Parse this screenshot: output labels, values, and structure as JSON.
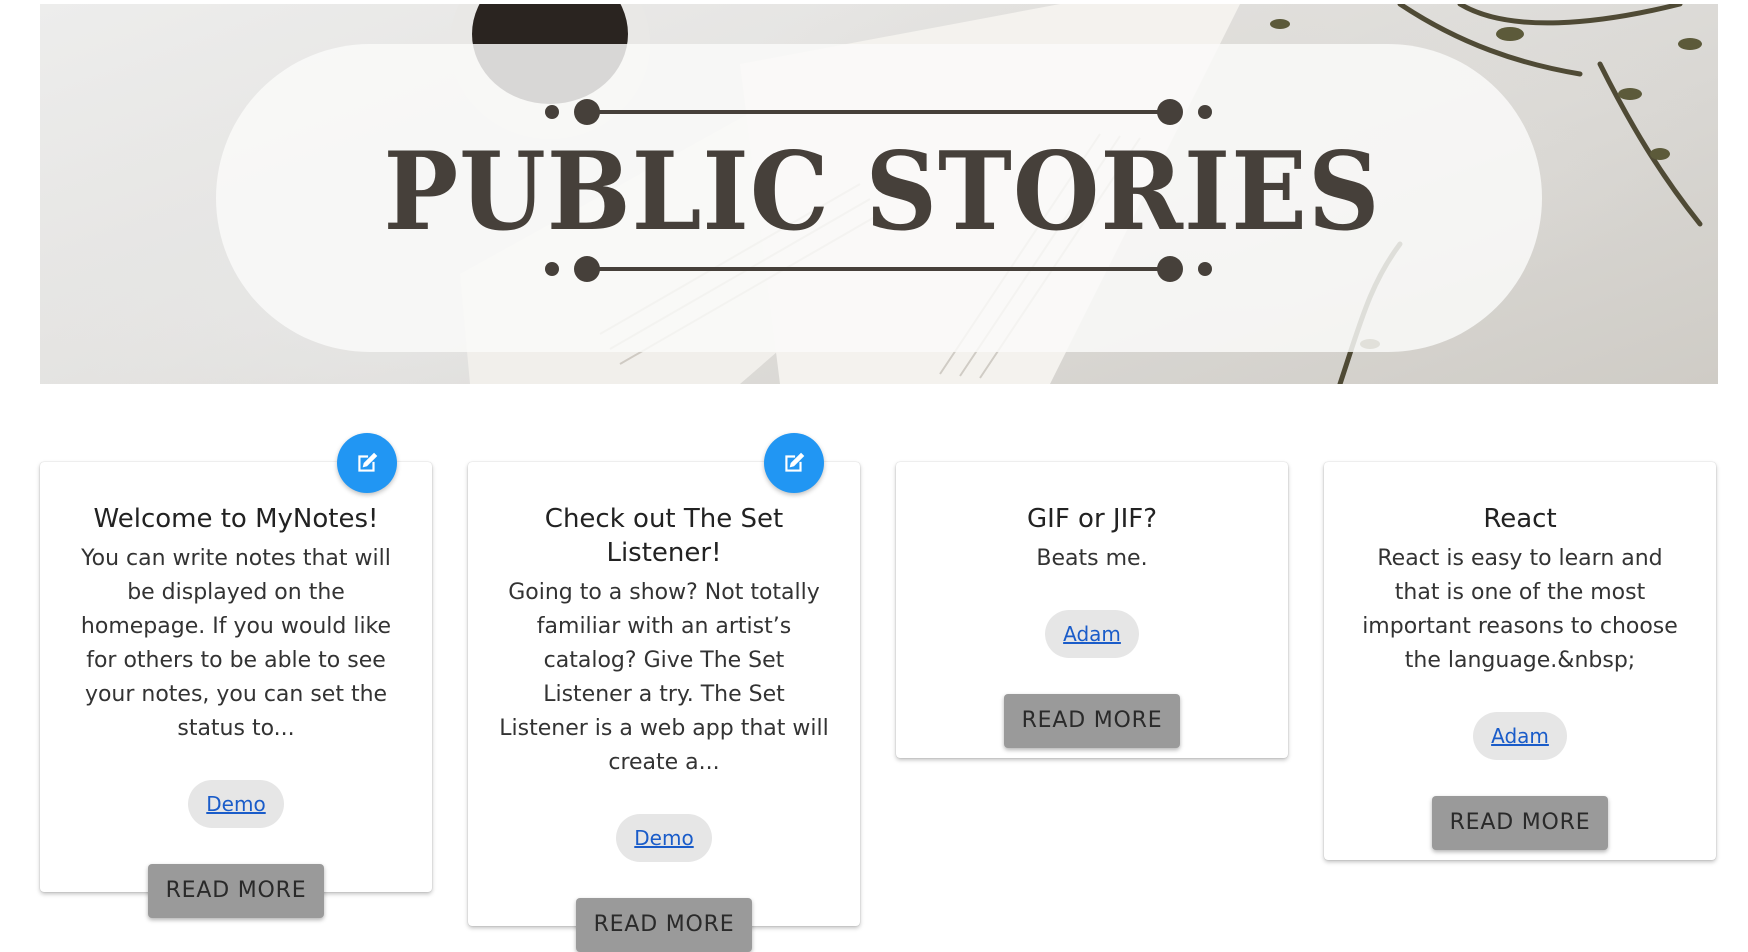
{
  "hero": {
    "title": "PUBLIC STORIES"
  },
  "cards": [
    {
      "title": "Welcome to MyNotes!",
      "body": "You can write notes that will be displayed on the homepage. If you would like for others to be able to see your notes, you can set the status to...",
      "author": "Demo",
      "button": "READ MORE",
      "editable": true,
      "edit_icon": "edit-icon"
    },
    {
      "title": "Check out The Set Listener!",
      "body": "Going to a show? Not totally familiar with an artist’s catalog? Give The Set Listener a try. The Set Listener is a web app that will create a...",
      "author": "Demo",
      "button": "READ MORE",
      "editable": true,
      "edit_icon": "edit-icon"
    },
    {
      "title": "GIF or JIF?",
      "body": "Beats me.",
      "author": "Adam",
      "button": "READ MORE",
      "editable": false
    },
    {
      "title": "React",
      "body": "React is easy to learn and that is one of the most important reasons to choose the language.&nbsp;",
      "author": "Adam",
      "button": "READ MORE",
      "editable": false
    }
  ],
  "colors": {
    "fab": "#2196f3",
    "button": "#9a9a9a",
    "chip": "#e6e6e6",
    "link": "#1a5cc9",
    "hero_title": "#46403a"
  }
}
